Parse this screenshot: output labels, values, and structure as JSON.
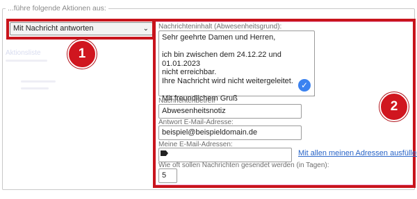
{
  "legend": "...führe folgende Aktionen aus:",
  "action_select": {
    "value": "Mit Nachricht antworten"
  },
  "badges": {
    "first": "1",
    "second": "2"
  },
  "faded_left": {
    "label": "Aktionsliste"
  },
  "message": {
    "label": "Nachrichteninhalt (Abwesenheitsgrund):",
    "body": "Sehr geehrte Damen und Herren,\n\nich bin zwischen dem 24.12.22 und 01.01.2023\nnicht erreichbar.\nIhre Nachricht wird nicht weitergeleitet.\n\nMit freundlichem Gruß"
  },
  "subject": {
    "label": "Nachrichtenbetreff",
    "value": "Abwesenheitsnotiz"
  },
  "reply_address": {
    "label": "Antwort E-Mail-Adresse:",
    "value": "beispiel@beispieldomain.de"
  },
  "my_addresses": {
    "label": "Meine E-Mail-Adressen:",
    "value": "",
    "fill_link": "Mit allen meinen Adressen ausfüllen"
  },
  "frequency": {
    "label": "Wie oft sollen Nachrichten gesendet werden (in Tagen):",
    "value": "5"
  },
  "colors": {
    "highlight": "#c8141c",
    "badge": "#d0161f",
    "link": "#2864c8",
    "check": "#3b82f0"
  }
}
